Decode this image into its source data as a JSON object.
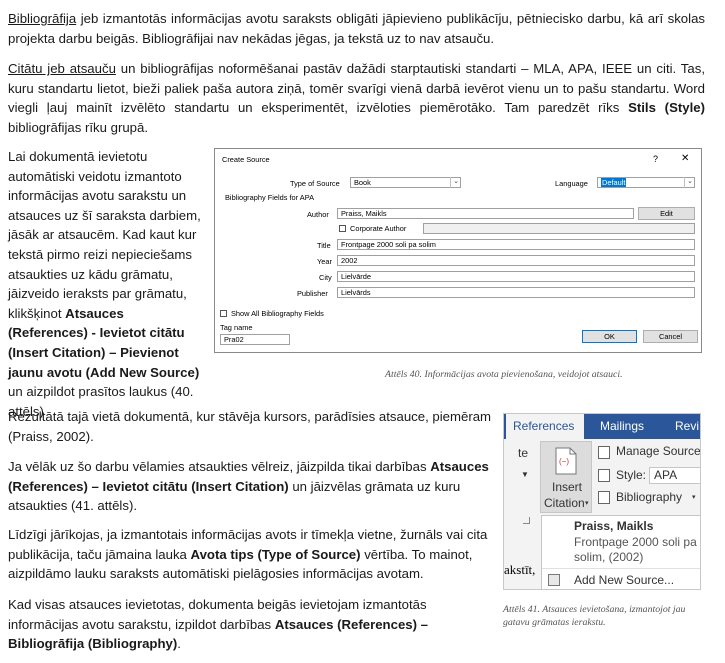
{
  "para1": {
    "term": "Bibliogrāfija",
    "text": " jeb izmantotās informācijas avotu saraksts obligāti jāpievieno publikācīju, pētniecisko darbu, kā arī skolas projekta darbu beigās. Bibliogrāfijai nav nekādas jēgas, ja tekstā uz to nav atsauču."
  },
  "para2": {
    "term": "Citātu jeb atsauču",
    "text_a": " un bibliogrāfijas noformēšanai pastāv dažādi starptautiski standarti – MLA, APA, IEEE un citi. Tas, kuru standartu lietot, bieži paliek paša autora ziņā, tomēr svarīgi vienā darbā ievērot vienu un to pašu standartu. Word viegli ļauj mainīt izvēlēto standartu un eksperimentēt, izvēloties piemērotāko. Tam paredzēt rīks ",
    "bold": "Stils (Style)",
    "text_b": " bibliogrāfijas rīku grupā."
  },
  "para3": {
    "text_a": "Lai dokumentā ievietotu automātiski veidotu izmantoto informācijas avotu sarakstu un atsauces uz šī saraksta darbiem, jāsāk ar atsaucēm. Kad kaut kur tekstā pirmo reizi nepieciešams atsaukties uz kādu grāmatu, jāizveido ieraksts par grāmatu, klikšķinot ",
    "bold": "Atsauces (References) - Ievietot citātu (Insert Citation) – Pievienot jaunu avotu (Add New Source)",
    "text_b": " un aizpildot prasītos laukus (40. attēls)"
  },
  "para4": {
    "text": "Rezultātā tajā vietā dokumentā, kur stāvēja kursors, parādīsies atsauce, piemēram (Praiss, 2002)."
  },
  "para5": {
    "text_a": "Ja vēlāk uz šo darbu vēlamies atsaukties vēlreiz, jāizpilda tikai darbības ",
    "bold": "Atsauces (References) – Ievietot citātu (Insert Citation)",
    "text_b": " un jāizvēlas grāmata uz kuru atsaukties (41. attēls)."
  },
  "para6": {
    "text_a": "Līdzīgi jārīkojas, ja izmantotais informācijas avots ir tīmekļa vietne, žurnāls vai cita publikācija, taču jāmaina lauka ",
    "bold": "Avota tips (Type of Source)",
    "text_b": " vērtība. To mainot, aizpildāmo lauku saraksts automātiski pielāgosies informācijas avotam."
  },
  "para7": {
    "text_a": "Kad visas atsauces ievietotas, dokumenta beigās ievietojam izmantotās informācijas avotu sarakstu, izpildot darbības ",
    "bold": "Atsauces (References) – Bibliogrāfija (Bibliography)",
    "text_b": "."
  },
  "dialog": {
    "title": "Create Source",
    "help": "?",
    "close": "✕",
    "type_label": "Type of Source",
    "type_value": "Book",
    "language_label": "Language",
    "language_value": "Default",
    "fields_heading": "Bibliography Fields for APA",
    "author_label": "Author",
    "author_value": "Praiss, Maikls",
    "edit_button": "Edit",
    "corporate_label": "Corporate Author",
    "title_label": "Title",
    "title_value": "Frontpage 2000 soli pa solim",
    "year_label": "Year",
    "year_value": "2002",
    "city_label": "City",
    "city_value": "Lielvārde",
    "publisher_label": "Publisher",
    "publisher_value": "Lielvārds",
    "show_all_label": "Show All Bibliography Fields",
    "tag_label": "Tag name",
    "tag_value": "Pra02",
    "ok": "OK",
    "cancel": "Cancel"
  },
  "caption40": "Attēls 40. Informācijas avota pievienošana, veidojot atsauci.",
  "ribbon": {
    "tabs": [
      "References",
      "Mailings",
      "Revi"
    ],
    "insert_citation": "Insert Citation",
    "insert_label_line1": "Insert",
    "insert_label_line2": "Citation",
    "manage_sources": "Manage Sources",
    "style_label": "Style:",
    "style_value": "APA",
    "bibliography": "Bibliography",
    "left_fragment_top": "te",
    "left_fragment_bottom": "akstīt,",
    "source_author": "Praiss, Maikls",
    "source_title_line1": "Frontpage 2000 soli pa",
    "source_title_line2": "solim, (2002)",
    "add_new_source": "Add New Source..."
  },
  "caption41": "Attēls 41. Atsauces ievietošana, izmantojot jau gatavu grāmatas ierakstu."
}
